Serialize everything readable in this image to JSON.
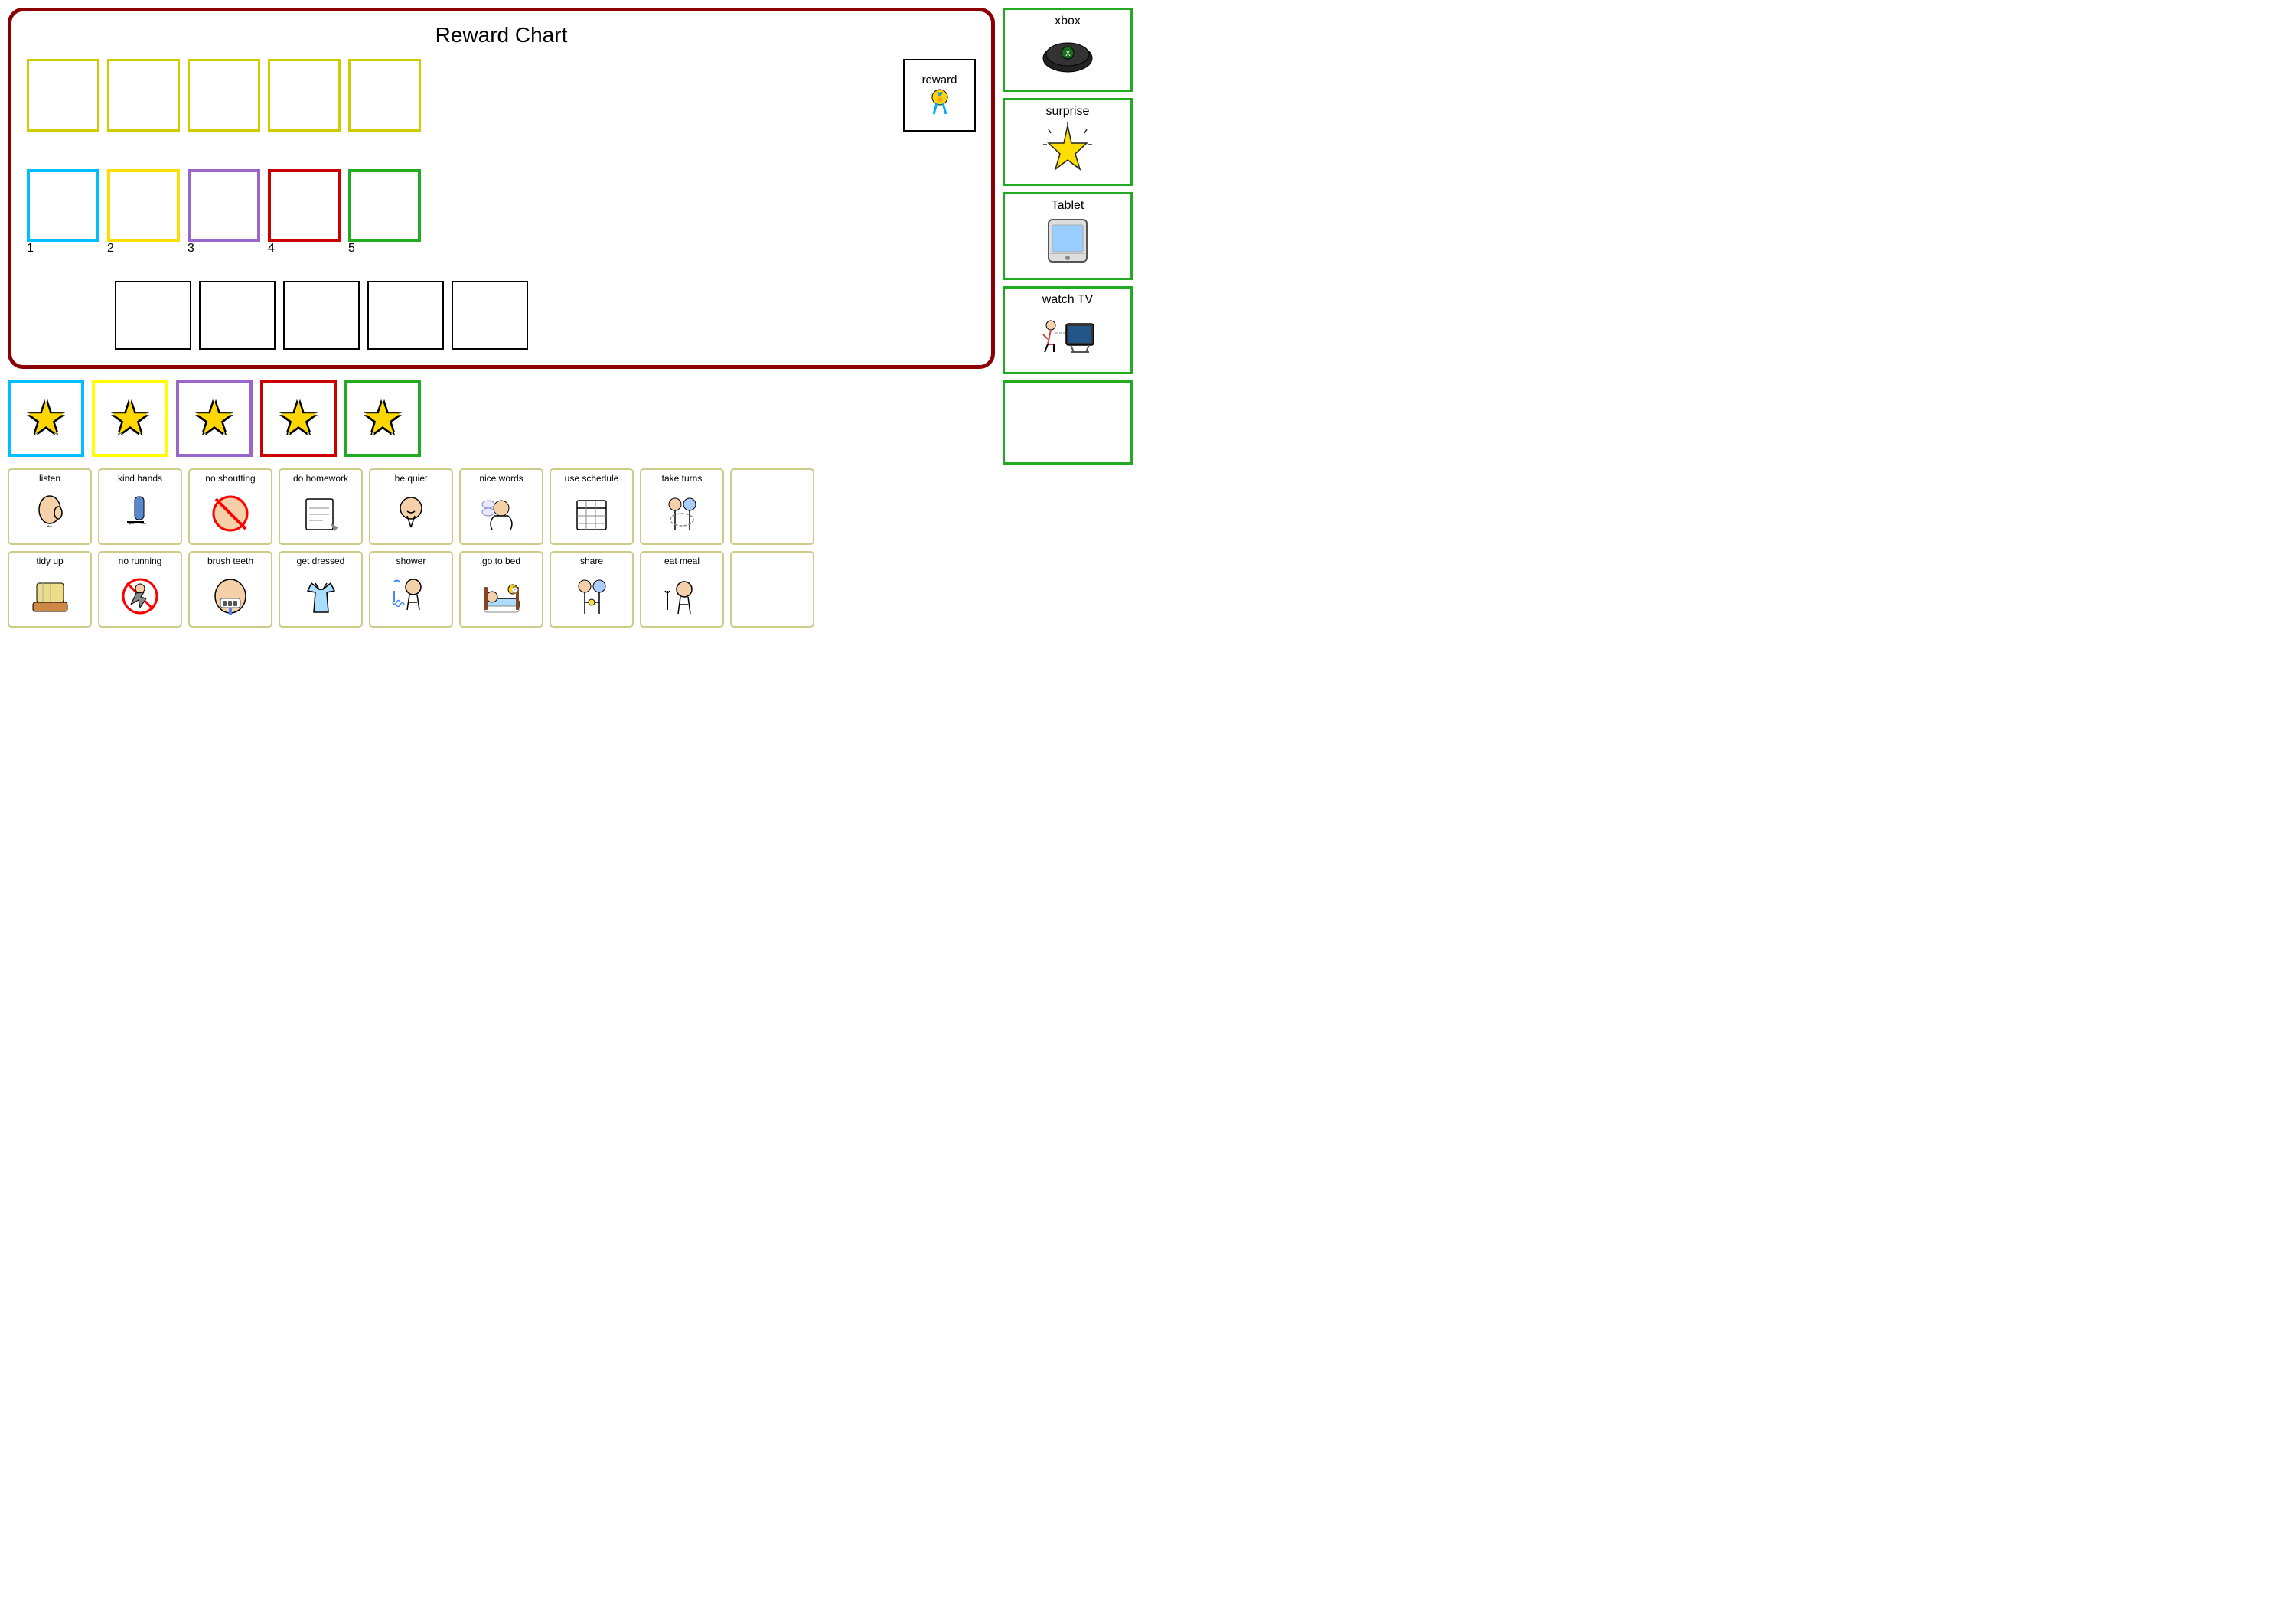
{
  "rewardChart": {
    "title": "Reward Chart",
    "row1": {
      "cells": [
        {
          "color": "#cccc00"
        },
        {
          "color": "#cccc00"
        },
        {
          "color": "#cccc00"
        },
        {
          "color": "#cccc00"
        },
        {
          "color": "#cccc00"
        }
      ]
    },
    "row2": {
      "cells": [
        {
          "color": "#00bfff",
          "number": "1"
        },
        {
          "color": "#ffdd00",
          "number": "2"
        },
        {
          "color": "#9966cc",
          "number": "3"
        },
        {
          "color": "#cc0000",
          "number": "4"
        },
        {
          "color": "#22aa22",
          "number": "5"
        }
      ],
      "rewardLabel": "reward",
      "rewardIcon": "🏅"
    }
  },
  "stars": [
    {
      "color": "#00bfff"
    },
    {
      "color": "#ffdd00"
    },
    {
      "color": "#9966cc"
    },
    {
      "color": "#cc0000"
    },
    {
      "color": "#22aa22"
    }
  ],
  "taskCards": {
    "row1": [
      {
        "label": "listen",
        "icon": "👂"
      },
      {
        "label": "kind hands",
        "icon": "🤝"
      },
      {
        "label": "no shoutting",
        "icon": "🔇"
      },
      {
        "label": "do homework",
        "icon": "📖"
      },
      {
        "label": "be quiet",
        "icon": "🤫"
      },
      {
        "label": "nice words",
        "icon": "💬"
      },
      {
        "label": "use schedule",
        "icon": "📅"
      },
      {
        "label": "take turns",
        "icon": "👥"
      },
      {
        "label": "",
        "icon": ""
      }
    ],
    "row2": [
      {
        "label": "tidy up",
        "icon": "🧹"
      },
      {
        "label": "no running",
        "icon": "🚫"
      },
      {
        "label": "brush teeth",
        "icon": "🦷"
      },
      {
        "label": "get dressed",
        "icon": "👕"
      },
      {
        "label": "shower",
        "icon": "🚿"
      },
      {
        "label": "go to bed",
        "icon": "🛏️"
      },
      {
        "label": "share",
        "icon": "🤲"
      },
      {
        "label": "eat meal",
        "icon": "🍽️"
      },
      {
        "label": "",
        "icon": ""
      }
    ]
  },
  "rewards": [
    {
      "label": "xbox",
      "icon": "🎮"
    },
    {
      "label": "surprise",
      "icon": "⭐"
    },
    {
      "label": "Tablet",
      "icon": "📱"
    },
    {
      "label": "watch TV",
      "icon": "📺"
    },
    {
      "label": "",
      "icon": ""
    }
  ]
}
